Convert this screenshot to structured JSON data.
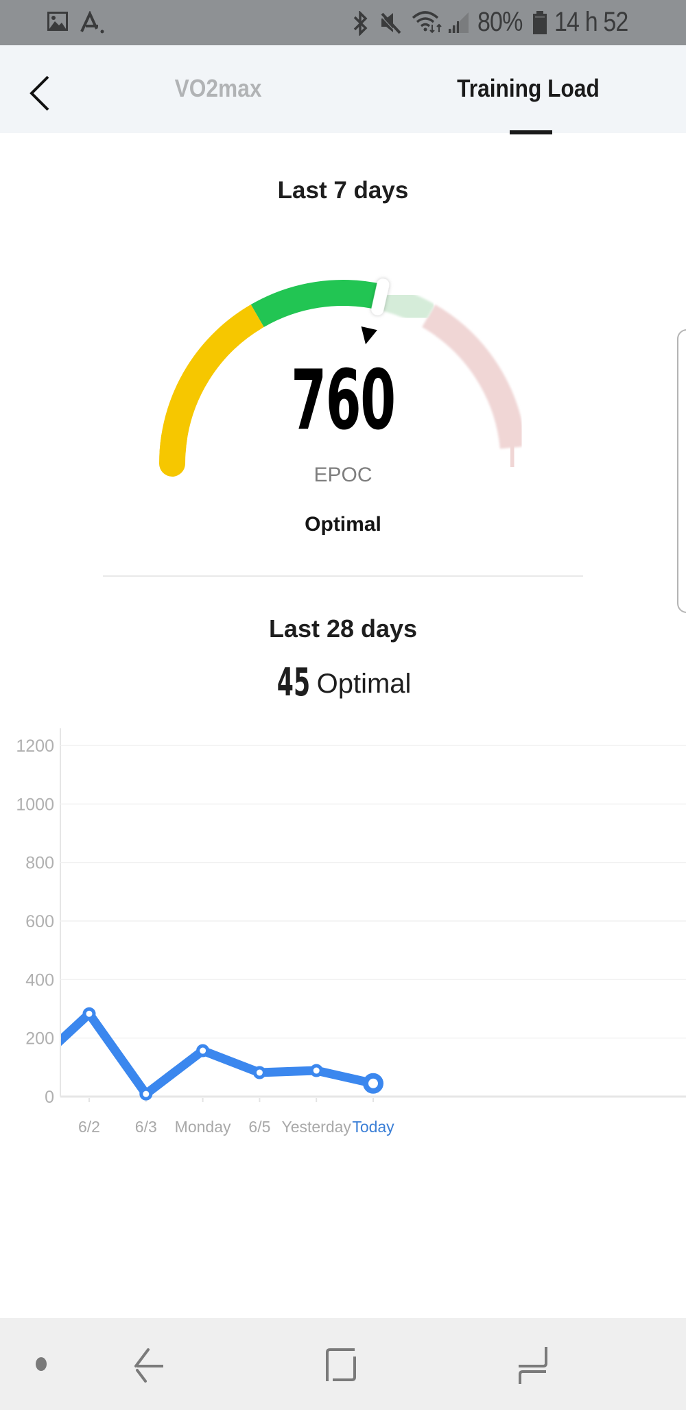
{
  "status_bar": {
    "icons_left": [
      "gallery-icon",
      "a-notification-icon"
    ],
    "icons_right": [
      "bluetooth-icon",
      "mute-icon",
      "wifi-icon",
      "signal-icon",
      "battery-icon"
    ],
    "battery": "80%",
    "time": "14 h 52"
  },
  "header": {
    "back_icon": "chevron-left-icon",
    "tabs": [
      {
        "label": "VO2max",
        "active": false
      },
      {
        "label": "Training Load",
        "active": true
      }
    ]
  },
  "last7": {
    "title": "Last 7 days",
    "value": "760",
    "unit": "EPOC",
    "status": "Optimal",
    "gauge": {
      "zones": [
        {
          "name": "low",
          "color": "#f6c700"
        },
        {
          "name": "optimal",
          "color": "#22c553"
        },
        {
          "name": "optimal-upper",
          "color": "#d5ecd9"
        },
        {
          "name": "high",
          "color": "#f0d6d5"
        }
      ],
      "zone_bounds_fraction": [
        0,
        0.333,
        0.667,
        1.0
      ],
      "value_fraction": 0.57
    }
  },
  "last28": {
    "title": "Last 28 days",
    "value": "45",
    "status": "Optimal"
  },
  "chart_data": {
    "type": "line",
    "title": "",
    "xlabel": "",
    "ylabel": "",
    "categories": [
      "6/2",
      "6/3",
      "Monday",
      "6/5",
      "Yesterday",
      "Today"
    ],
    "series": [
      {
        "name": "EPOC",
        "color": "#3b87ee",
        "values": [
          283,
          9,
          157,
          82,
          89,
          45
        ]
      }
    ],
    "previous_point_clipped": 103,
    "ylim": [
      0,
      1200
    ],
    "yticks": [
      0,
      200,
      400,
      600,
      800,
      1000,
      1200
    ],
    "grid": true,
    "highlight_category": "Today",
    "highlight_color": "#3b7fd6"
  },
  "nav_bar": {
    "buttons": [
      "dot-icon",
      "back-icon",
      "home-icon",
      "recents-icon"
    ]
  }
}
